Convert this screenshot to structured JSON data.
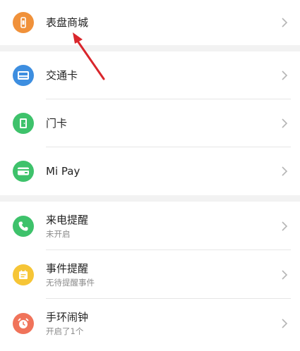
{
  "colors": {
    "orange": "#f0913a",
    "blue": "#3d8ee0",
    "green": "#3ec26b",
    "yellow": "#f6c536",
    "red": "#f0735a",
    "chevron": "#b5b5b5",
    "annotation_arrow": "#d9262c"
  },
  "groups": [
    {
      "items": [
        {
          "title": "表盘商城",
          "subtitle": "",
          "icon": "watch-icon",
          "color": "orange"
        }
      ]
    },
    {
      "items": [
        {
          "title": "交通卡",
          "subtitle": "",
          "icon": "bus-card-icon",
          "color": "blue"
        },
        {
          "title": "门卡",
          "subtitle": "",
          "icon": "door-icon",
          "color": "green"
        },
        {
          "title": "Mi Pay",
          "subtitle": "",
          "icon": "wallet-card-icon",
          "color": "green"
        }
      ]
    },
    {
      "items": [
        {
          "title": "来电提醒",
          "subtitle": "未开启",
          "icon": "phone-icon",
          "color": "green"
        },
        {
          "title": "事件提醒",
          "subtitle": "无待提醒事件",
          "icon": "calendar-icon",
          "color": "yellow"
        },
        {
          "title": "手环闹钟",
          "subtitle": "开启了1个",
          "icon": "alarm-clock-icon",
          "color": "red"
        }
      ]
    }
  ]
}
